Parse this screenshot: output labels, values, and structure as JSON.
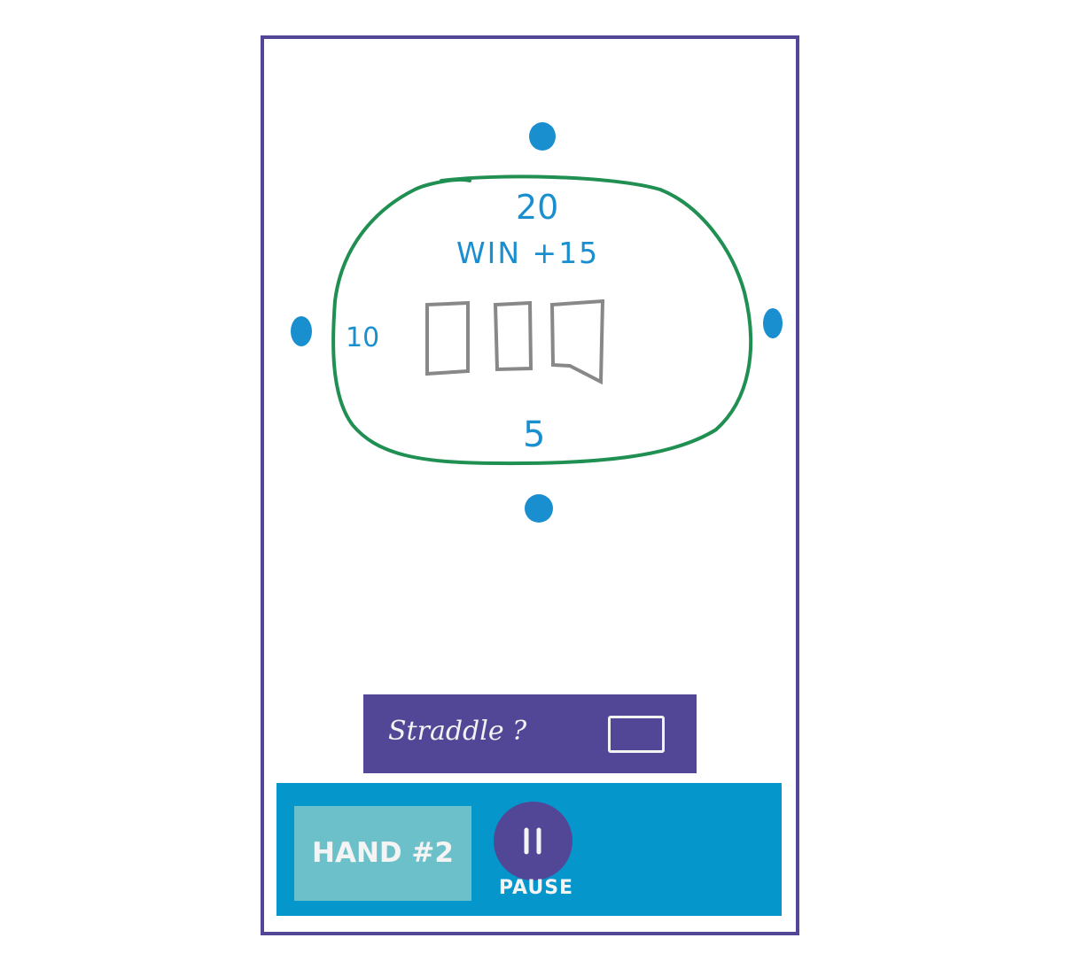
{
  "colors": {
    "frame": "#524796",
    "table_outline": "#1f8f52",
    "seat": "#1a8fd0",
    "card": "#888888",
    "straddle_bar": "#524796",
    "bottom_bar": "#0597cc",
    "hand_button": "#6cc0c9",
    "pause_button": "#524796"
  },
  "table": {
    "top_bet": "20",
    "win_text": "WIN +15",
    "left_bet": "10",
    "bottom_bet": "5",
    "community_card_count": 3
  },
  "seats": [
    "seat-top",
    "seat-left",
    "seat-right",
    "seat-bottom"
  ],
  "straddle": {
    "label": "Straddle ?",
    "checked": true
  },
  "bottom_bar": {
    "hand_label": "HAND #2",
    "pause_icon": "pause-icon",
    "pause_label": "PAUSE"
  }
}
